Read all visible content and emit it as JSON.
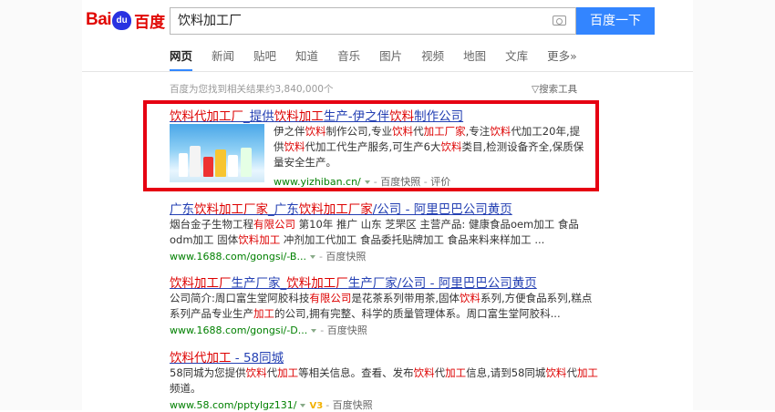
{
  "header": {
    "logo_bai": "Bai",
    "logo_du": "du",
    "logo_cn": "百度",
    "search_value": "饮料加工厂",
    "search_button": "百度一下"
  },
  "tabs": [
    {
      "label": "网页",
      "active": true
    },
    {
      "label": "新闻"
    },
    {
      "label": "贴吧"
    },
    {
      "label": "知道"
    },
    {
      "label": "音乐"
    },
    {
      "label": "图片"
    },
    {
      "label": "视频"
    },
    {
      "label": "地图"
    },
    {
      "label": "文库"
    },
    {
      "label": "更多»"
    }
  ],
  "result_stats": "百度为您找到相关结果约3,840,000个",
  "search_tools": "搜索工具",
  "results": [
    {
      "title_html": "<em>饮料代加工厂</em>_提供<em>饮料加工</em>生产-伊之伴<em>饮料</em>制作公司",
      "desc_html": "伊之伴<em>饮料</em>制作公司,专业<em>饮料</em>代<em>加工厂家</em>,专注<em>饮料</em>代加工20年,提供<em>饮料</em>代加工代生产服务,可生产6大<em>饮料</em>类目,检测设备齐全,保质保量安全生产。",
      "url": "www.yizhiban.cn/",
      "snapshot": "百度快照",
      "extra": "评价"
    },
    {
      "title_html": "广东<em>饮料加工厂家</em>_广东<em>饮料加工厂家</em>/公司 - 阿里巴巴公司黄页",
      "desc_html": "烟台金子生物工程<em>有限公司</em> 第10年 推广 山东 芝罘区 主营产品: 健康食品oem加工 食品odm加工 固体<em>饮料加工</em> 冲剂加工代加工 食品委托贴牌加工 食品来料来样加工 ...",
      "url": "www.1688.com/gongsi/-B...",
      "snapshot": "百度快照"
    },
    {
      "title_html": "<em>饮料加工厂</em>生产厂家_<em>饮料加工厂</em>生产厂家/公司 - 阿里巴巴公司黄页",
      "desc_html": "公司简介:周口富生堂阿胶科技<em>有限公司</em>是花茶系列带用茶,固体<em>饮料</em>系列,方便食品系列,糕点系列产品专业生产<em>加工</em>的公司,拥有完整、科学的质量管理体系。周口富生堂阿胶科...",
      "url": "www.1688.com/gongsi/-D...",
      "snapshot": "百度快照"
    },
    {
      "title_html": "<em>饮料代加工</em> - 58同城",
      "desc_html": "58同城为您提供<em>饮料</em>代<em>加工</em>等相关信息。查看、发布<em>饮料</em>代<em>加工</em>信息,请到58同城<em>饮料</em>代<em>加工</em>频道。",
      "url": "www.58.com/pptylgz131/",
      "v_badge": "V3",
      "snapshot": "百度快照"
    }
  ]
}
